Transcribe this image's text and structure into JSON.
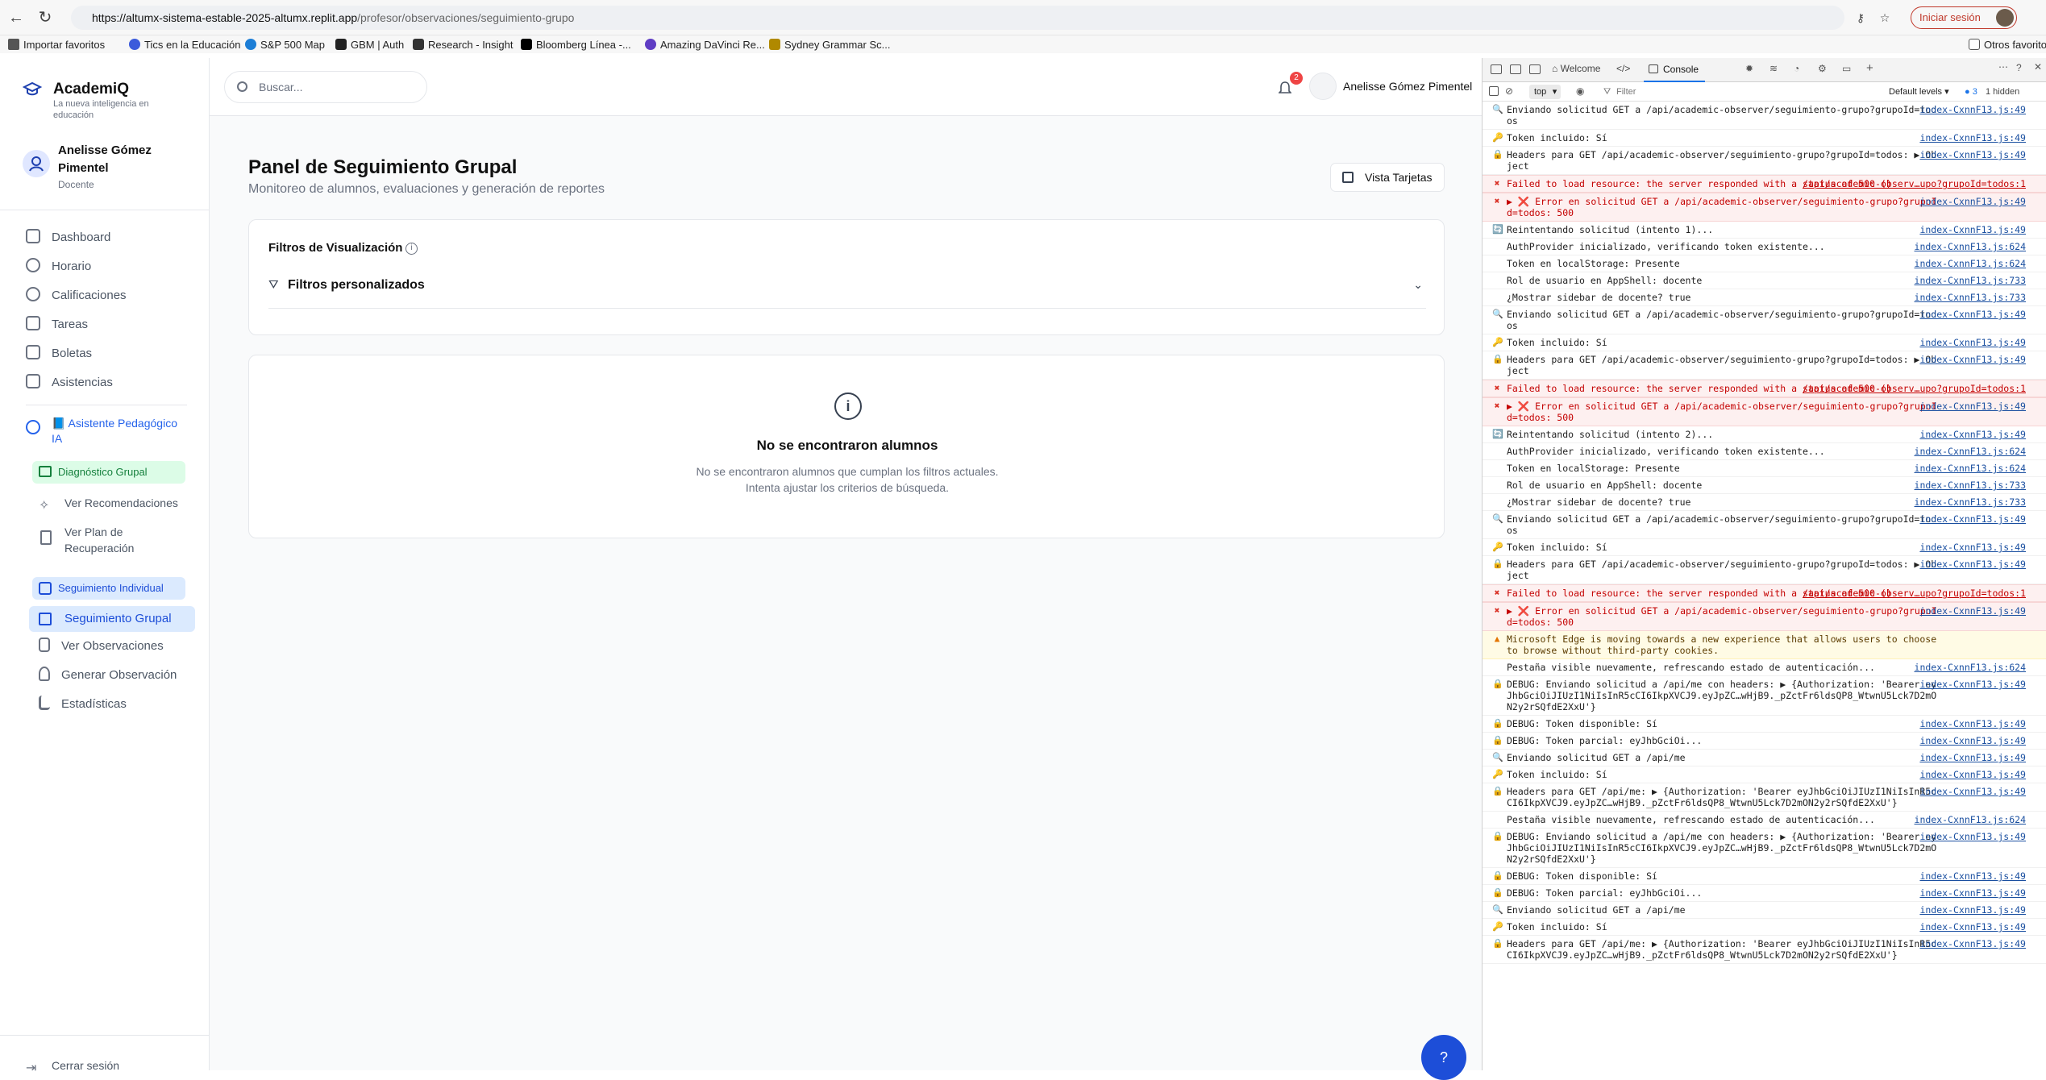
{
  "browser": {
    "url_domain": "https://altumx-sistema-estable-2025-altumx.replit.app",
    "url_path": "/profesor/observaciones/seguimiento-grupo",
    "signin_label": "Iniciar sesión",
    "bookmarks": [
      {
        "label": "Importar favoritos",
        "color": "#555555"
      },
      {
        "label": "Tics en la Educación",
        "color": "#3b5bdb"
      },
      {
        "label": "S&P 500 Map",
        "color": "#1c7ed6"
      },
      {
        "label": "GBM | Auth",
        "color": "#222222"
      },
      {
        "label": "Research - Insight",
        "color": "#333333"
      },
      {
        "label": "Bloomberg Línea -...",
        "color": "#000000"
      },
      {
        "label": "Amazing DaVinci Re...",
        "color": "#5f3dc4"
      },
      {
        "label": "Sydney Grammar Sc...",
        "color": "#b08900"
      }
    ],
    "other_favorites": "Otros favorito"
  },
  "sidebar": {
    "brand": "AcademiQ",
    "tagline": "La nueva inteligencia en educación",
    "user_name": "Anelisse Gómez Pimentel",
    "user_role": "Docente",
    "items": [
      {
        "label": "Dashboard"
      },
      {
        "label": "Horario"
      },
      {
        "label": "Calificaciones"
      },
      {
        "label": "Tareas"
      },
      {
        "label": "Boletas"
      },
      {
        "label": "Asistencias"
      }
    ],
    "assistant_label": "📘 Asistente Pedagógico IA",
    "diagnostico": "Diagnóstico Grupal",
    "recomendaciones": "Ver Recomendaciones",
    "plan": "Ver Plan de Recuperación",
    "seguimiento_individual": "Seguimiento Individual",
    "seguimiento_grupal": "Seguimiento Grupal",
    "observaciones": "Ver Observaciones",
    "generar": "Generar Observación",
    "estadisticas": "Estadísticas",
    "logout": "Cerrar sesión"
  },
  "topbar": {
    "search_placeholder": "Buscar...",
    "notif_count": "2",
    "user_name": "Anelisse Gómez Pimentel"
  },
  "main": {
    "title": "Panel de Seguimiento Grupal",
    "subtitle": "Monitoreo de alumnos, evaluaciones y generación de reportes",
    "view_button": "Vista Tarjetas",
    "filters_title": "Filtros de Visualización",
    "filters_custom": "Filtros personalizados",
    "empty_title": "No se encontraron alumnos",
    "empty_text": "No se encontraron alumnos que cumplan los filtros actuales. Intenta ajustar los criterios de búsqueda."
  },
  "devtools": {
    "tabs": [
      "Welcome",
      "Console"
    ],
    "context": "top",
    "filter_placeholder": "Filter",
    "levels": "Default levels",
    "issues": "3",
    "hidden": "1 hidden",
    "logs": [
      {
        "type": "info",
        "icon": "🔍",
        "text": "Enviando solicitud GET a /api/academic-observer/seguimiento-grupo?grupoId=todos",
        "src": "index-CxnnF13.js:49"
      },
      {
        "type": "info",
        "icon": "🔑",
        "text": "Token incluido: Sí",
        "src": "index-CxnnF13.js:49"
      },
      {
        "type": "info",
        "icon": "🔒",
        "text": "Headers para GET /api/academic-observer/seguimiento-grupo?grupoId=todos: ▶ Object",
        "src": "index-CxnnF13.js:49"
      },
      {
        "type": "error",
        "icon": "✖",
        "text": "Failed to load resource: the server responded with a status of 500 ()",
        "src": "/api/academic-observ…upo?grupoId=todos:1"
      },
      {
        "type": "error",
        "icon": "✖",
        "text": "▶ ❌ Error en solicitud GET a /api/academic-observer/seguimiento-grupo?grupoId=todos: 500",
        "src": "index-CxnnF13.js:49"
      },
      {
        "type": "info",
        "icon": "🔄",
        "text": "Reintentando solicitud (intento 1)...",
        "src": "index-CxnnF13.js:49"
      },
      {
        "type": "info",
        "icon": "",
        "text": "AuthProvider inicializado, verificando token existente...",
        "src": "index-CxnnF13.js:624"
      },
      {
        "type": "info",
        "icon": "",
        "text": "Token en localStorage: Presente",
        "src": "index-CxnnF13.js:624"
      },
      {
        "type": "info",
        "icon": "",
        "text": "Rol de usuario en AppShell: docente",
        "src": "index-CxnnF13.js:733"
      },
      {
        "type": "info",
        "icon": "",
        "text": "¿Mostrar sidebar de docente? true",
        "src": "index-CxnnF13.js:733"
      },
      {
        "type": "info",
        "icon": "🔍",
        "text": "Enviando solicitud GET a /api/academic-observer/seguimiento-grupo?grupoId=todos",
        "src": "index-CxnnF13.js:49"
      },
      {
        "type": "info",
        "icon": "🔑",
        "text": "Token incluido: Sí",
        "src": "index-CxnnF13.js:49"
      },
      {
        "type": "info",
        "icon": "🔒",
        "text": "Headers para GET /api/academic-observer/seguimiento-grupo?grupoId=todos: ▶ Object",
        "src": "index-CxnnF13.js:49"
      },
      {
        "type": "error",
        "icon": "✖",
        "text": "Failed to load resource: the server responded with a status of 500 ()",
        "src": "/api/academic-observ…upo?grupoId=todos:1"
      },
      {
        "type": "error",
        "icon": "✖",
        "text": "▶ ❌ Error en solicitud GET a /api/academic-observer/seguimiento-grupo?grupoId=todos: 500",
        "src": "index-CxnnF13.js:49"
      },
      {
        "type": "info",
        "icon": "🔄",
        "text": "Reintentando solicitud (intento 2)...",
        "src": "index-CxnnF13.js:49"
      },
      {
        "type": "info",
        "icon": "",
        "text": "AuthProvider inicializado, verificando token existente...",
        "src": "index-CxnnF13.js:624"
      },
      {
        "type": "info",
        "icon": "",
        "text": "Token en localStorage: Presente",
        "src": "index-CxnnF13.js:624"
      },
      {
        "type": "info",
        "icon": "",
        "text": "Rol de usuario en AppShell: docente",
        "src": "index-CxnnF13.js:733"
      },
      {
        "type": "info",
        "icon": "",
        "text": "¿Mostrar sidebar de docente? true",
        "src": "index-CxnnF13.js:733"
      },
      {
        "type": "info",
        "icon": "🔍",
        "text": "Enviando solicitud GET a /api/academic-observer/seguimiento-grupo?grupoId=todos",
        "src": "index-CxnnF13.js:49"
      },
      {
        "type": "info",
        "icon": "🔑",
        "text": "Token incluido: Sí",
        "src": "index-CxnnF13.js:49"
      },
      {
        "type": "info",
        "icon": "🔒",
        "text": "Headers para GET /api/academic-observer/seguimiento-grupo?grupoId=todos: ▶ Object",
        "src": "index-CxnnF13.js:49"
      },
      {
        "type": "error",
        "icon": "✖",
        "text": "Failed to load resource: the server responded with a status of 500 ()",
        "src": "/api/academic-observ…upo?grupoId=todos:1"
      },
      {
        "type": "error",
        "icon": "✖",
        "text": "▶ ❌ Error en solicitud GET a /api/academic-observer/seguimiento-grupo?grupoId=todos: 500",
        "src": "index-CxnnF13.js:49"
      },
      {
        "type": "warning",
        "icon": "▲",
        "text": "Microsoft Edge is moving towards a new experience that allows users to choose to browse without third-party cookies.",
        "src": ""
      },
      {
        "type": "info",
        "icon": "",
        "text": "Pestaña visible nuevamente, refrescando estado de autenticación...",
        "src": "index-CxnnF13.js:624"
      },
      {
        "type": "info",
        "icon": "🔒",
        "text": "DEBUG: Enviando solicitud a /api/me con headers: ▶ {Authorization: 'Bearer eyJhbGciOiJIUzI1NiIsInR5cCI6IkpXVCJ9.eyJpZC…wHjB9._pZctFr6ldsQP8_WtwnU5Lck7D2mON2y2rSQfdE2XxU'}",
        "src": "index-CxnnF13.js:49"
      },
      {
        "type": "info",
        "icon": "🔒",
        "text": "DEBUG: Token disponible: Sí",
        "src": "index-CxnnF13.js:49"
      },
      {
        "type": "info",
        "icon": "🔒",
        "text": "DEBUG: Token parcial: eyJhbGciOi...",
        "src": "index-CxnnF13.js:49"
      },
      {
        "type": "info",
        "icon": "🔍",
        "text": "Enviando solicitud GET a /api/me",
        "src": "index-CxnnF13.js:49"
      },
      {
        "type": "info",
        "icon": "🔑",
        "text": "Token incluido: Sí",
        "src": "index-CxnnF13.js:49"
      },
      {
        "type": "info",
        "icon": "🔒",
        "text": "Headers para GET /api/me: ▶ {Authorization: 'Bearer eyJhbGciOiJIUzI1NiIsInR5cCI6IkpXVCJ9.eyJpZC…wHjB9._pZctFr6ldsQP8_WtwnU5Lck7D2mON2y2rSQfdE2XxU'}",
        "src": "index-CxnnF13.js:49"
      },
      {
        "type": "info",
        "icon": "",
        "text": "Pestaña visible nuevamente, refrescando estado de autenticación...",
        "src": "index-CxnnF13.js:624"
      },
      {
        "type": "info",
        "icon": "🔒",
        "text": "DEBUG: Enviando solicitud a /api/me con headers: ▶ {Authorization: 'Bearer eyJhbGciOiJIUzI1NiIsInR5cCI6IkpXVCJ9.eyJpZC…wHjB9._pZctFr6ldsQP8_WtwnU5Lck7D2mON2y2rSQfdE2XxU'}",
        "src": "index-CxnnF13.js:49"
      },
      {
        "type": "info",
        "icon": "🔒",
        "text": "DEBUG: Token disponible: Sí",
        "src": "index-CxnnF13.js:49"
      },
      {
        "type": "info",
        "icon": "🔒",
        "text": "DEBUG: Token parcial: eyJhbGciOi...",
        "src": "index-CxnnF13.js:49"
      },
      {
        "type": "info",
        "icon": "🔍",
        "text": "Enviando solicitud GET a /api/me",
        "src": "index-CxnnF13.js:49"
      },
      {
        "type": "info",
        "icon": "🔑",
        "text": "Token incluido: Sí",
        "src": "index-CxnnF13.js:49"
      },
      {
        "type": "info",
        "icon": "🔒",
        "text": "Headers para GET /api/me: ▶ {Authorization: 'Bearer eyJhbGciOiJIUzI1NiIsInR5cCI6IkpXVCJ9.eyJpZC…wHjB9._pZctFr6ldsQP8_WtwnU5Lck7D2mON2y2rSQfdE2XxU'}",
        "src": "index-CxnnF13.js:49"
      }
    ]
  }
}
